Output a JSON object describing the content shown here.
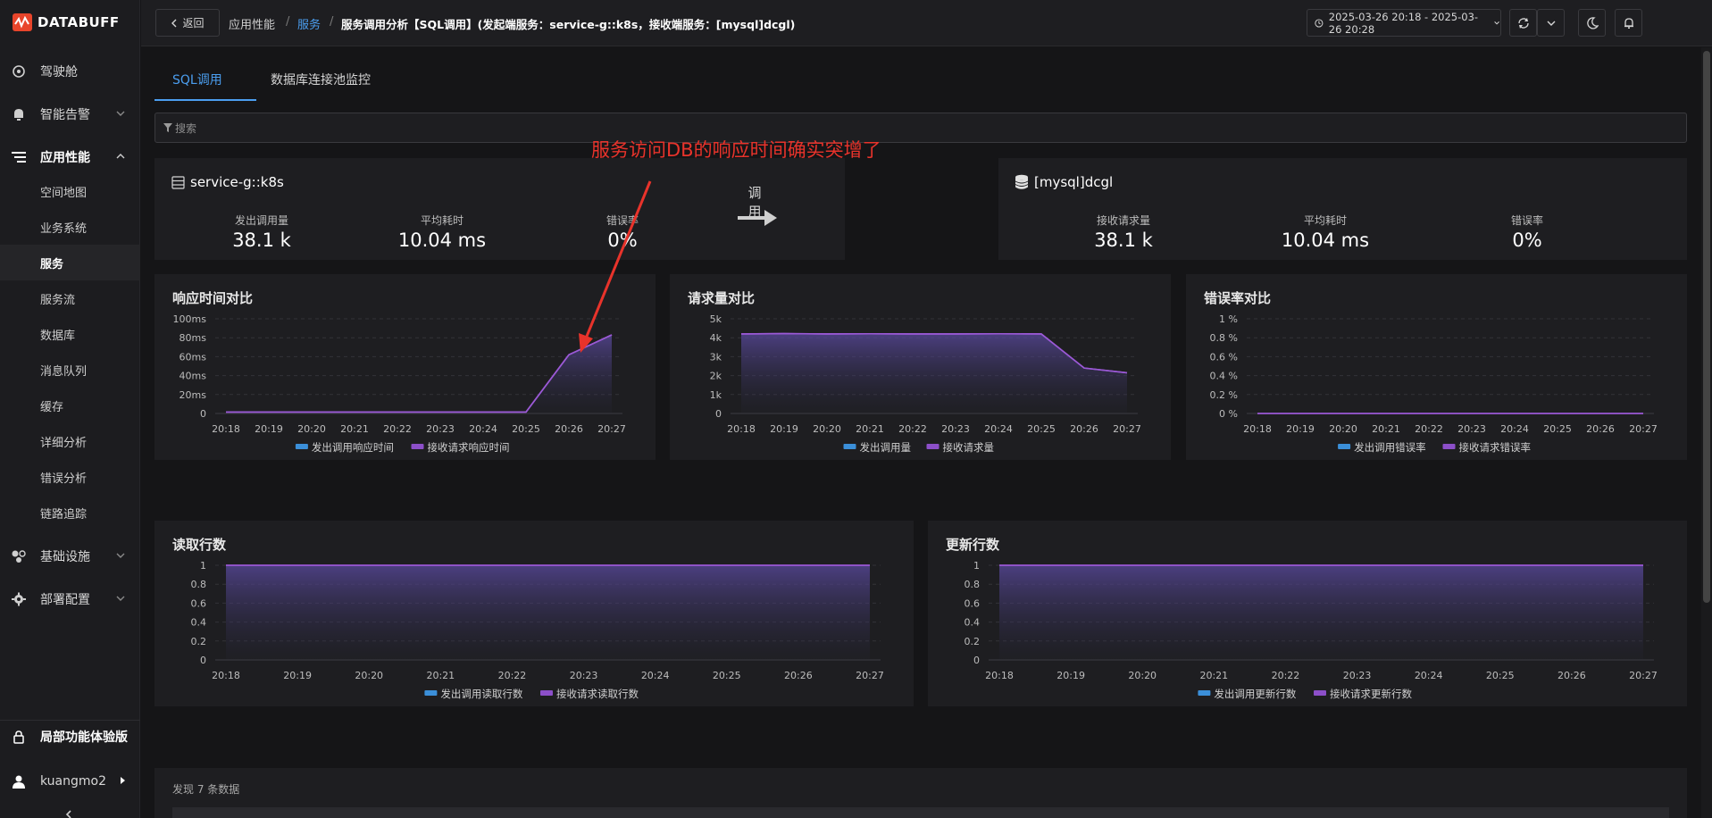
{
  "brand": {
    "name": "DATABUFF"
  },
  "sidebar": {
    "items": [
      {
        "label": "驾驶舱",
        "icon": "cockpit-icon"
      },
      {
        "label": "智能告警",
        "icon": "bell-icon"
      },
      {
        "label": "应用性能",
        "icon": "app-perf-icon"
      },
      {
        "label": "基础设施",
        "icon": "infra-icon"
      },
      {
        "label": "部署配置",
        "icon": "gear-icon"
      }
    ],
    "subitems": [
      "空间地图",
      "业务系统",
      "服务",
      "服务流",
      "数据库",
      "消息队列",
      "缓存",
      "详细分析",
      "错误分析",
      "链路追踪"
    ],
    "bottom_label": "局部功能体验版",
    "user": "kuangmo2"
  },
  "header": {
    "back_label": "返回",
    "crumbs": [
      "应用性能",
      "服务",
      "服务调用分析【SQL调用】(发起端服务：service-g::k8s，接收端服务：[mysql]dcgl)"
    ],
    "time_range": "2025-03-26 20:18 - 2025-03-26 20:28"
  },
  "tabs": [
    "SQL调用",
    "数据库连接池监控"
  ],
  "search": {
    "placeholder": "搜索"
  },
  "annotation": "服务访问DB的响应时间确实突增了",
  "caller": {
    "name": "service-g::k8s",
    "metrics": [
      {
        "label": "发出调用量",
        "value": "38.1 k"
      },
      {
        "label": "平均耗时",
        "value": "10.04 ms"
      },
      {
        "label": "错误率",
        "value": "0%"
      }
    ]
  },
  "call_label": "调用",
  "callee": {
    "name": "[mysql]dcgl",
    "metrics": [
      {
        "label": "接收请求量",
        "value": "38.1 k"
      },
      {
        "label": "平均耗时",
        "value": "10.04 ms"
      },
      {
        "label": "错误率",
        "value": "0%"
      }
    ]
  },
  "colors": {
    "series1": "#3b8fd9",
    "series2": "#8c4fc9",
    "accent": "#4b9ef0",
    "annotation": "#e8332b",
    "line": "#9b59d6"
  },
  "chart_data": [
    {
      "type": "area",
      "title": "响应时间对比",
      "x": [
        "20:18",
        "20:19",
        "20:20",
        "20:21",
        "20:22",
        "20:23",
        "20:24",
        "20:25",
        "20:26",
        "20:27"
      ],
      "yticks": [
        "0",
        "20ms",
        "40ms",
        "60ms",
        "80ms",
        "100ms"
      ],
      "ylim": [
        0,
        100
      ],
      "series": [
        {
          "name": "发出调用响应时间",
          "values": [
            1.5,
            1.5,
            1.5,
            1.5,
            1.5,
            1.5,
            1.5,
            1.5,
            62,
            83
          ]
        },
        {
          "name": "接收请求响应时间",
          "values": [
            1.5,
            1.5,
            1.5,
            1.5,
            1.5,
            1.5,
            1.5,
            1.5,
            62,
            83
          ]
        }
      ]
    },
    {
      "type": "area",
      "title": "请求量对比",
      "x": [
        "20:18",
        "20:19",
        "20:20",
        "20:21",
        "20:22",
        "20:23",
        "20:24",
        "20:25",
        "20:26",
        "20:27"
      ],
      "yticks": [
        "0",
        "1k",
        "2k",
        "3k",
        "4k",
        "5k"
      ],
      "ylim": [
        0,
        5000
      ],
      "series": [
        {
          "name": "发出调用量",
          "values": [
            4200,
            4220,
            4200,
            4210,
            4200,
            4200,
            4210,
            4200,
            2400,
            2150
          ]
        },
        {
          "name": "接收请求量",
          "values": [
            4200,
            4220,
            4200,
            4210,
            4200,
            4200,
            4210,
            4200,
            2400,
            2150
          ]
        }
      ]
    },
    {
      "type": "area",
      "title": "错误率对比",
      "x": [
        "20:18",
        "20:19",
        "20:20",
        "20:21",
        "20:22",
        "20:23",
        "20:24",
        "20:25",
        "20:26",
        "20:27"
      ],
      "yticks": [
        "0 %",
        "0.2 %",
        "0.4 %",
        "0.6 %",
        "0.8 %",
        "1 %"
      ],
      "ylim": [
        0,
        1
      ],
      "series": [
        {
          "name": "发出调用错误率",
          "values": [
            0,
            0,
            0,
            0,
            0,
            0,
            0,
            0,
            0,
            0
          ]
        },
        {
          "name": "接收请求错误率",
          "values": [
            0,
            0,
            0,
            0,
            0,
            0,
            0,
            0,
            0,
            0
          ]
        }
      ]
    },
    {
      "type": "area",
      "title": "读取行数",
      "x": [
        "20:18",
        "20:19",
        "20:20",
        "20:21",
        "20:22",
        "20:23",
        "20:24",
        "20:25",
        "20:26",
        "20:27"
      ],
      "yticks": [
        "0",
        "0.2",
        "0.4",
        "0.6",
        "0.8",
        "1"
      ],
      "ylim": [
        0,
        1
      ],
      "series": [
        {
          "name": "发出调用读取行数",
          "values": [
            1,
            1,
            1,
            1,
            1,
            1,
            1,
            1,
            1,
            1
          ]
        },
        {
          "name": "接收请求读取行数",
          "values": [
            1,
            1,
            1,
            1,
            1,
            1,
            1,
            1,
            1,
            1
          ]
        }
      ]
    },
    {
      "type": "area",
      "title": "更新行数",
      "x": [
        "20:18",
        "20:19",
        "20:20",
        "20:21",
        "20:22",
        "20:23",
        "20:24",
        "20:25",
        "20:26",
        "20:27"
      ],
      "yticks": [
        "0",
        "0.2",
        "0.4",
        "0.6",
        "0.8",
        "1"
      ],
      "ylim": [
        0,
        1
      ],
      "series": [
        {
          "name": "发出调用更新行数",
          "values": [
            1,
            1,
            1,
            1,
            1,
            1,
            1,
            1,
            1,
            1
          ]
        },
        {
          "name": "接收请求更新行数",
          "values": [
            1,
            1,
            1,
            1,
            1,
            1,
            1,
            1,
            1,
            1
          ]
        }
      ]
    }
  ],
  "footer": {
    "count_text": "发现 7 条数据"
  }
}
